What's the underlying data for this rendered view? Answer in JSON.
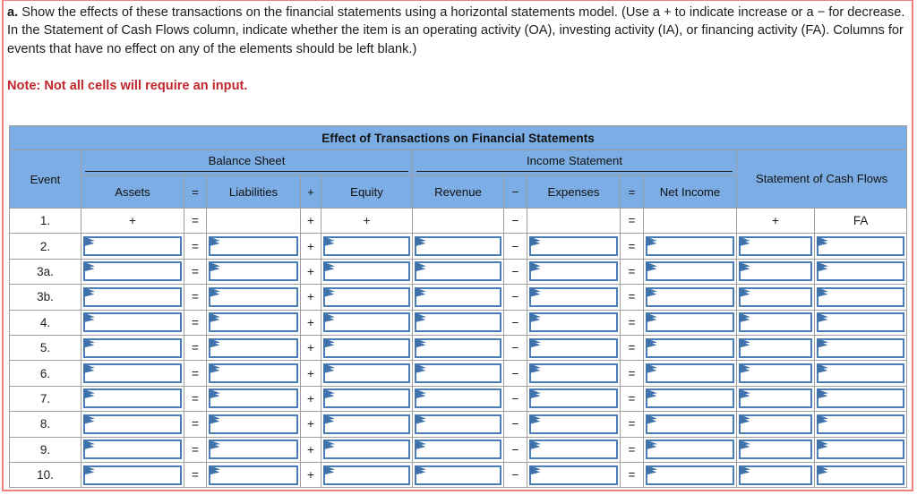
{
  "instructions": {
    "label": "a.",
    "text": " Show the effects of these transactions on the financial statements using a horizontal statements model. (Use a + to indicate increase or a − for decrease. In the Statement of Cash Flows column, indicate whether the item is an operating activity (OA), investing activity (IA), or financing activity (FA). Columns for events that have no effect on any of the elements should be left blank.)",
    "note": "Note: Not all cells will require an input."
  },
  "table": {
    "title": "Effect of Transactions on Financial Statements",
    "groups": {
      "event": "Event",
      "balance_sheet": "Balance Sheet",
      "income_statement": "Income Statement",
      "cash_flows": "Statement of Cash Flows"
    },
    "columns": {
      "assets": "Assets",
      "eq1": "=",
      "liabilities": "Liabilities",
      "plus1": "+",
      "equity": "Equity",
      "revenue": "Revenue",
      "minus1": "−",
      "expenses": "Expenses",
      "eq2": "=",
      "net_income": "Net Income"
    },
    "row_operators": {
      "eq1": "=",
      "plus1": "+",
      "minus1": "−",
      "eq2": "="
    },
    "rows": [
      {
        "event": "1.",
        "assets": "+",
        "liabilities": "",
        "equity": "+",
        "revenue": "",
        "expenses": "",
        "net_income": "",
        "cash_amount": "+",
        "cash_activity": "FA",
        "input": false
      },
      {
        "event": "2.",
        "assets": "",
        "liabilities": "",
        "equity": "",
        "revenue": "",
        "expenses": "",
        "net_income": "",
        "cash_amount": "",
        "cash_activity": "",
        "input": true
      },
      {
        "event": "3a.",
        "assets": "",
        "liabilities": "",
        "equity": "",
        "revenue": "",
        "expenses": "",
        "net_income": "",
        "cash_amount": "",
        "cash_activity": "",
        "input": true
      },
      {
        "event": "3b.",
        "assets": "",
        "liabilities": "",
        "equity": "",
        "revenue": "",
        "expenses": "",
        "net_income": "",
        "cash_amount": "",
        "cash_activity": "",
        "input": true
      },
      {
        "event": "4.",
        "assets": "",
        "liabilities": "",
        "equity": "",
        "revenue": "",
        "expenses": "",
        "net_income": "",
        "cash_amount": "",
        "cash_activity": "",
        "input": true
      },
      {
        "event": "5.",
        "assets": "",
        "liabilities": "",
        "equity": "",
        "revenue": "",
        "expenses": "",
        "net_income": "",
        "cash_amount": "",
        "cash_activity": "",
        "input": true
      },
      {
        "event": "6.",
        "assets": "",
        "liabilities": "",
        "equity": "",
        "revenue": "",
        "expenses": "",
        "net_income": "",
        "cash_amount": "",
        "cash_activity": "",
        "input": true
      },
      {
        "event": "7.",
        "assets": "",
        "liabilities": "",
        "equity": "",
        "revenue": "",
        "expenses": "",
        "net_income": "",
        "cash_amount": "",
        "cash_activity": "",
        "input": true
      },
      {
        "event": "8.",
        "assets": "",
        "liabilities": "",
        "equity": "",
        "revenue": "",
        "expenses": "",
        "net_income": "",
        "cash_amount": "",
        "cash_activity": "",
        "input": true
      },
      {
        "event": "9.",
        "assets": "",
        "liabilities": "",
        "equity": "",
        "revenue": "",
        "expenses": "",
        "net_income": "",
        "cash_amount": "",
        "cash_activity": "",
        "input": true
      },
      {
        "event": "10.",
        "assets": "",
        "liabilities": "",
        "equity": "",
        "revenue": "",
        "expenses": "",
        "net_income": "",
        "cash_amount": "",
        "cash_activity": "",
        "input": true
      }
    ]
  },
  "colors": {
    "header_blue": "#7cade4",
    "input_border": "#4a7db5",
    "note_red": "#c0262c",
    "page_border": "#f08080"
  }
}
